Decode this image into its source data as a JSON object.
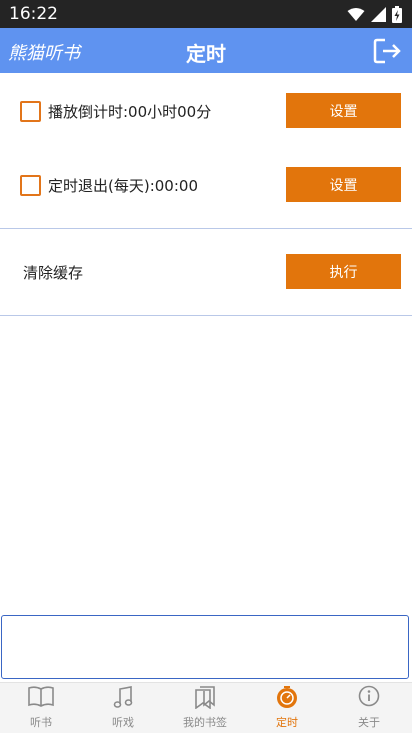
{
  "status_bar": {
    "time": "16:22"
  },
  "header": {
    "brand": "熊猫听书",
    "title": "定时"
  },
  "timer": {
    "playback_label": "播放倒计时:00小时00分",
    "playback_button": "设置",
    "daily_exit_label": "定时退出(每天):00:00",
    "daily_exit_button": "设置"
  },
  "cache": {
    "label": "清除缓存",
    "button": "执行"
  },
  "input": {
    "value": ""
  },
  "tabs": [
    {
      "label": "听书",
      "icon": "book-icon"
    },
    {
      "label": "听戏",
      "icon": "music-note-icon"
    },
    {
      "label": "我的书签",
      "icon": "bookmark-icon"
    },
    {
      "label": "定时",
      "icon": "timer-icon",
      "active": true
    },
    {
      "label": "关于",
      "icon": "info-icon"
    }
  ],
  "colors": {
    "header": "#5f93f0",
    "accent": "#e2750c",
    "status_bar": "#242424"
  }
}
